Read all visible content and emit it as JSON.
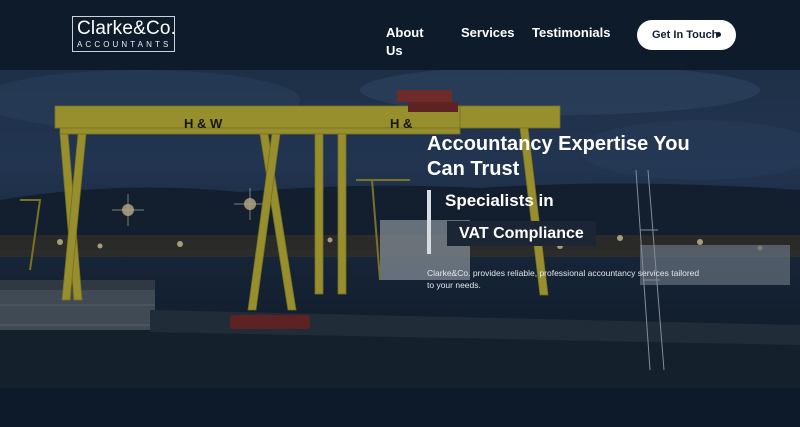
{
  "logo": {
    "name": "Clarke&Co.",
    "subtitle": "ACCOUNTANTS"
  },
  "nav": {
    "items": [
      "About Us",
      "Services",
      "Testimonials"
    ],
    "cta_label": "Get In Touch"
  },
  "hero": {
    "crane_text_left": "H & W",
    "crane_text_right": "H &",
    "heading": "Accountancy Expertise You Can Trust",
    "specialists_line1": "Specialists in",
    "specialists_line2": "VAT Compliance",
    "description": "Clarke&Co. provides reliable, professional accountancy services tailored to your needs."
  },
  "colors": {
    "navbar": "#0d1b2b",
    "crane": "#e3cf34",
    "cta_bg": "#ffffff",
    "cta_text": "#0f1f2f"
  }
}
